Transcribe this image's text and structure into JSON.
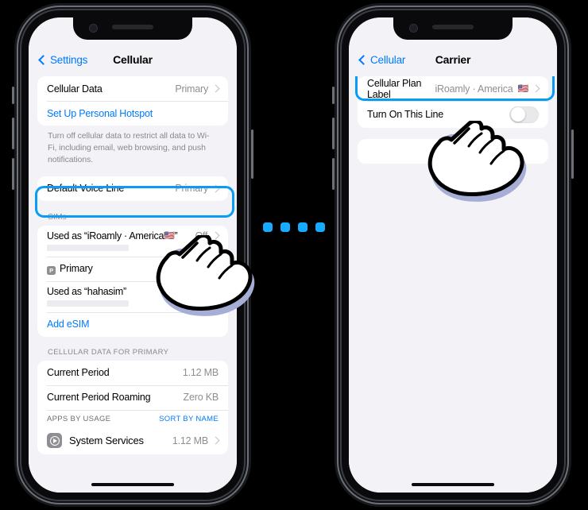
{
  "left_phone": {
    "nav": {
      "back_label": "Settings",
      "title": "Cellular",
      "back_icon": "chevron-left-icon"
    },
    "card1": {
      "rows": [
        {
          "label": "Cellular Data",
          "value": "Primary",
          "chevron": "chevron-right-icon"
        },
        {
          "label": "Set Up Personal Hotspot",
          "value": ""
        }
      ]
    },
    "footnote": "Turn off cellular data to restrict all data to Wi-Fi, including email, web browsing, and push notifications.",
    "card2": {
      "rows": [
        {
          "label": "Default Voice Line",
          "value": "Primary",
          "chevron": "chevron-right-icon"
        }
      ]
    },
    "sims_header": "SIMs",
    "sims": {
      "row1": {
        "label": "Used as “iRoamly · America",
        "flag": "🇺🇸",
        "label_end": "”",
        "value": "Off"
      },
      "row2": {
        "badge": "P",
        "label": "Primary"
      },
      "row3": {
        "label": "Used as “hahasim”"
      },
      "add_esim": "Add eSIM"
    },
    "usage_header": "CELLULAR DATA FOR PRIMARY",
    "usage": {
      "rows": [
        {
          "label": "Current Period",
          "value": "1.12 MB"
        },
        {
          "label": "Current Period Roaming",
          "value": "Zero KB"
        }
      ],
      "apps_header": "APPS BY USAGE",
      "sort_action": "SORT BY NAME",
      "app_row": {
        "icon": "system-services-icon",
        "label": "System Services",
        "value": "1.12 MB",
        "chevron": "chevron-right-icon"
      }
    }
  },
  "right_phone": {
    "nav": {
      "back_label": "Cellular",
      "title": "Carrier",
      "back_icon": "chevron-left-icon"
    },
    "card1": {
      "plan_label_title": "Cellular Plan Label",
      "plan_label_value": "iRoamly · America",
      "plan_label_flag": "🇺🇸",
      "toggle_label": "Turn On This Line",
      "toggle_state": "off"
    }
  },
  "separator": {
    "icon": "four-dots-icon",
    "count": 4
  },
  "colors": {
    "accent_blue": "#007aff",
    "highlight_blue": "#0a9cf5",
    "ios_bg": "#f2f2f7",
    "card_white": "#ffffff",
    "secondary_text": "#8e8e93"
  }
}
